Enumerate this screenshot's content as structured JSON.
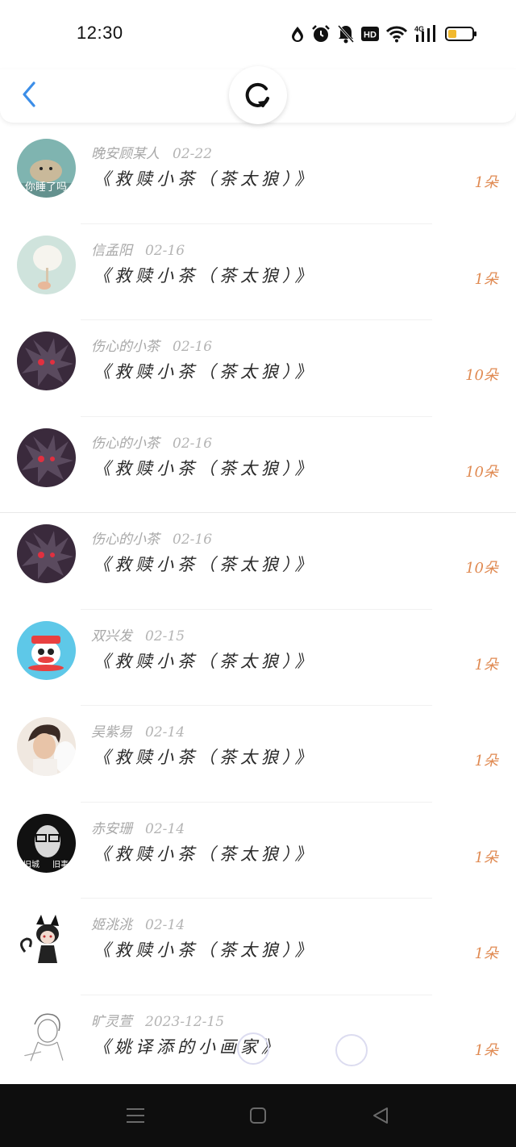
{
  "status_bar": {
    "time": "12:30",
    "icons": [
      "water-drop-icon",
      "alarm-icon",
      "bell-off-icon",
      "hd-icon",
      "wifi-icon",
      "signal-4g-icon",
      "battery-icon"
    ],
    "hd_label": "HD",
    "network_label": "4G"
  },
  "header": {
    "back_icon": "chevron-left-icon",
    "refresh_icon": "refresh-icon"
  },
  "colors": {
    "accent": "#3c8ee8",
    "count": "#e08a52",
    "meta": "#a8a8a8",
    "title": "#2a2a2a"
  },
  "items": [
    {
      "name": "晚安顾某人",
      "date": "02-22",
      "title": "《救赎小茶（茶太狼）》",
      "count": "1朵",
      "avatar": "seal-avatar",
      "avatar_text": "你睡了吗"
    },
    {
      "name": "信孟阳",
      "date": "02-16",
      "title": "《救赎小茶（茶太狼）》",
      "count": "1朵",
      "avatar": "cotton-candy-avatar"
    },
    {
      "name": "伤心的小茶",
      "date": "02-16",
      "title": "《救赎小茶（茶太狼）》",
      "count": "10朵",
      "avatar": "dark-wolf-avatar"
    },
    {
      "name": "伤心的小茶",
      "date": "02-16",
      "title": "《救赎小茶（茶太狼）》",
      "count": "10朵",
      "avatar": "dark-wolf-avatar"
    },
    {
      "name": "伤心的小茶",
      "date": "02-16",
      "title": "《救赎小茶（茶太狼）》",
      "count": "10朵",
      "avatar": "dark-wolf-avatar"
    },
    {
      "name": "双兴发",
      "date": "02-15",
      "title": "《救赎小茶（茶太狼）》",
      "count": "1朵",
      "avatar": "monkey-cartoon-avatar"
    },
    {
      "name": "吴紫易",
      "date": "02-14",
      "title": "《救赎小茶（茶太狼）》",
      "count": "1朵",
      "avatar": "portrait-avatar"
    },
    {
      "name": "赤安珊",
      "date": "02-14",
      "title": "《救赎小茶（茶太狼）》",
      "count": "1朵",
      "avatar": "glasses-avatar",
      "avatar_left_text": "旧城",
      "avatar_right_text": "旧事"
    },
    {
      "name": "姬洮洮",
      "date": "02-14",
      "title": "《救赎小茶（茶太狼）》",
      "count": "1朵",
      "avatar": "cat-girl-avatar"
    },
    {
      "name": "旷灵萱",
      "date": "2023-12-15",
      "title": "《姚译添的小画家》",
      "count": "1朵",
      "avatar": "sketch-avatar"
    }
  ],
  "nav": {
    "icons": [
      "menu-icon",
      "home-square-icon",
      "back-triangle-icon"
    ]
  }
}
